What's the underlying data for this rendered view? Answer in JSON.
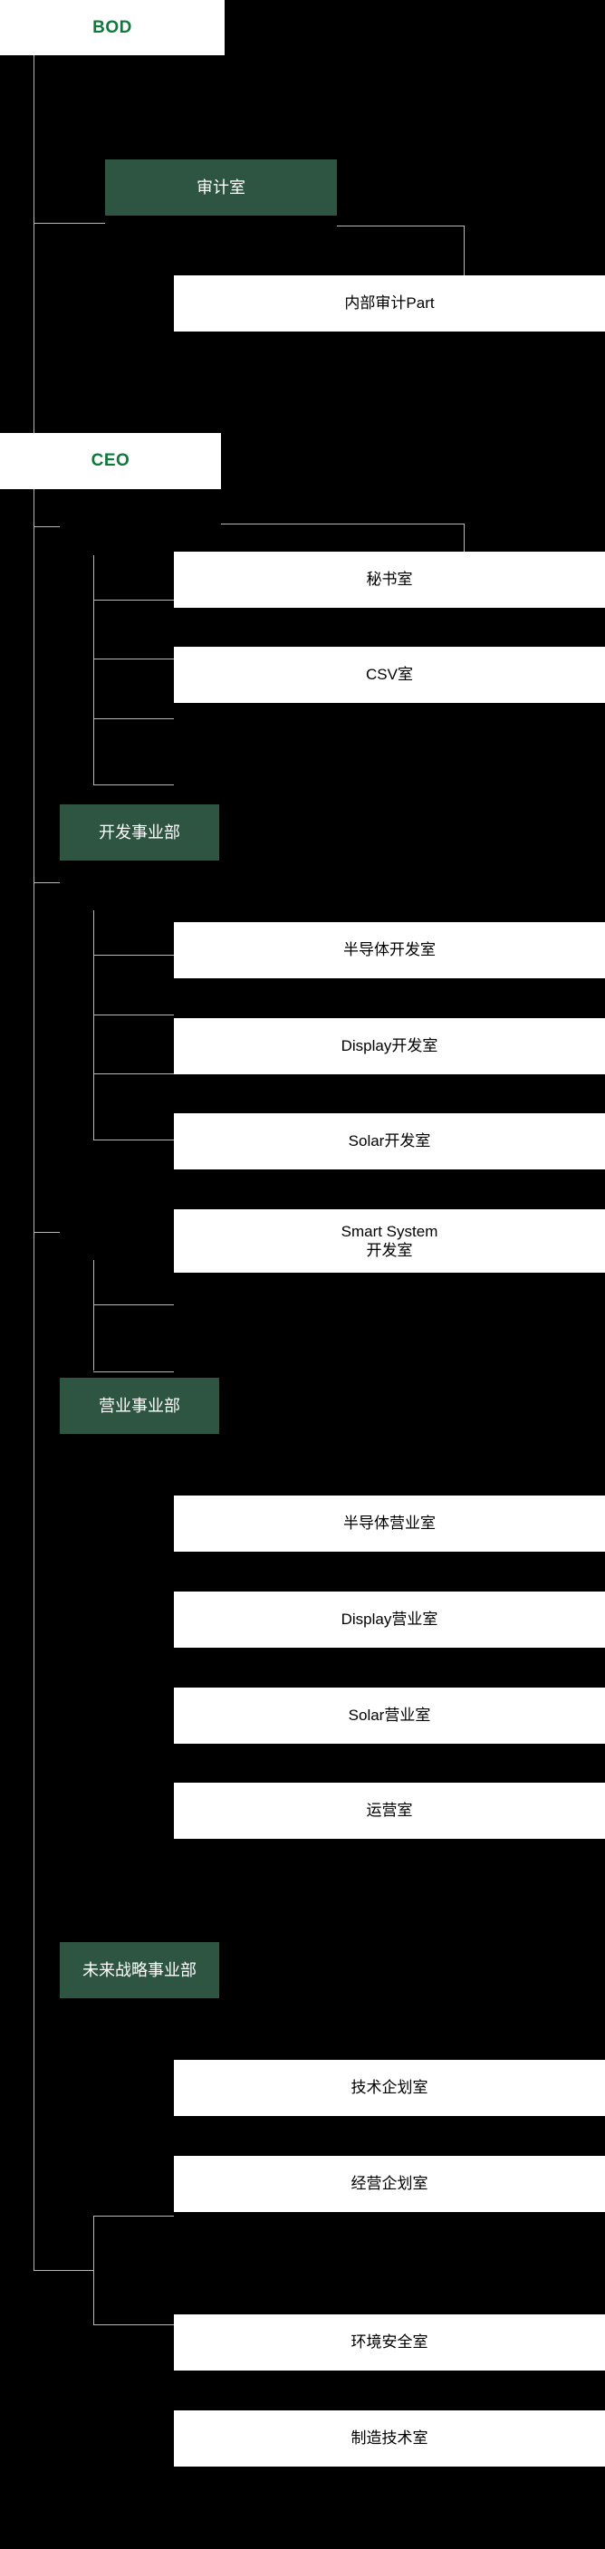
{
  "chart_data": {
    "type": "diagram",
    "title": "Organization Chart",
    "orientation": "vertical-left-spine",
    "colors": {
      "background": "#000000",
      "division_box": "#2d5541",
      "division_text": "#ffffff",
      "leaf_box": "#ffffff",
      "leaf_text": "#000000",
      "executive_text": "#0b7a3b",
      "connector": "#b9b9b9"
    },
    "nodes": [
      {
        "id": "bod",
        "label": "BOD",
        "level": 0,
        "style": "white-accent"
      },
      {
        "id": "audit",
        "label": "审计室",
        "level": 1,
        "style": "green",
        "parent": "bod"
      },
      {
        "id": "audit_part",
        "label": "内部审计Part",
        "level": 2,
        "style": "white",
        "parent": "audit"
      },
      {
        "id": "ceo",
        "label": "CEO",
        "level": 0,
        "style": "white-accent",
        "parent": "bod"
      },
      {
        "id": "secretary",
        "label": "秘书室",
        "level": 1,
        "style": "white",
        "parent": "ceo"
      },
      {
        "id": "csv",
        "label": "CSV室",
        "level": 1,
        "style": "white",
        "parent": "ceo"
      },
      {
        "id": "dev_div",
        "label": "开发事业部",
        "level": 1,
        "style": "green",
        "parent": "ceo"
      },
      {
        "id": "dev_semi",
        "label": "半导体开发室",
        "level": 2,
        "style": "white",
        "parent": "dev_div"
      },
      {
        "id": "dev_display",
        "label": "Display开发室",
        "level": 2,
        "style": "white",
        "parent": "dev_div"
      },
      {
        "id": "dev_solar",
        "label": "Solar开发室",
        "level": 2,
        "style": "white",
        "parent": "dev_div"
      },
      {
        "id": "dev_smart",
        "label": "Smart System\n开发室",
        "level": 2,
        "style": "white",
        "parent": "dev_div"
      },
      {
        "id": "sales_div",
        "label": "营业事业部",
        "level": 1,
        "style": "green",
        "parent": "ceo"
      },
      {
        "id": "sales_semi",
        "label": "半导体营业室",
        "level": 2,
        "style": "white",
        "parent": "sales_div"
      },
      {
        "id": "sales_display",
        "label": "Display营业室",
        "level": 2,
        "style": "white",
        "parent": "sales_div"
      },
      {
        "id": "sales_solar",
        "label": "Solar营业室",
        "level": 2,
        "style": "white",
        "parent": "sales_div"
      },
      {
        "id": "sales_ops",
        "label": "运营室",
        "level": 2,
        "style": "white",
        "parent": "sales_div"
      },
      {
        "id": "future_div",
        "label": "未来战略事业部",
        "level": 1,
        "style": "green",
        "parent": "ceo"
      },
      {
        "id": "tech_plan",
        "label": "技术企划室",
        "level": 2,
        "style": "white",
        "parent": "future_div"
      },
      {
        "id": "biz_plan",
        "label": "经营企划室",
        "level": 2,
        "style": "white",
        "parent": "future_div"
      },
      {
        "id": "env_safety",
        "label": "环境安全室",
        "level": 2,
        "style": "white",
        "parent": "ceo"
      },
      {
        "id": "mfg_tech",
        "label": "制造技术室",
        "level": 2,
        "style": "white",
        "parent": "ceo"
      }
    ]
  },
  "nodes": {
    "bod": "BOD",
    "audit": "审计室",
    "audit_part": "内部审计Part",
    "ceo": "CEO",
    "secretary": "秘书室",
    "csv": "CSV室",
    "dev_div": "开发事业部",
    "dev_semi": "半导体开发室",
    "dev_display": "Display开发室",
    "dev_solar": "Solar开发室",
    "dev_smart_l1": "Smart System",
    "dev_smart_l2": "开发室",
    "sales_div": "营业事业部",
    "sales_semi": "半导体营业室",
    "sales_display": "Display营业室",
    "sales_solar": "Solar营业室",
    "sales_ops": "运营室",
    "future_div": "未来战略事业部",
    "tech_plan": "技术企划室",
    "biz_plan": "经营企划室",
    "env_safety": "环境安全室",
    "mfg_tech": "制造技术室"
  }
}
